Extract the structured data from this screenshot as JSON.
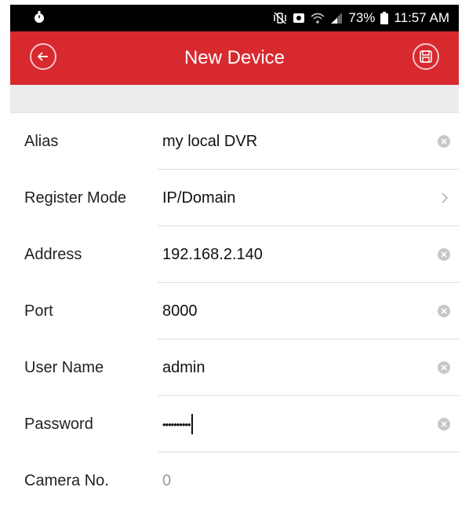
{
  "status_bar": {
    "left_icon": "stopwatch-icon",
    "icons": [
      "mute-vibrate-icon",
      "alarm-icon",
      "wifi-icon",
      "signal-icon"
    ],
    "battery_text": "73%",
    "battery_icon": "battery-icon",
    "time": "11:57 AM"
  },
  "header": {
    "title": "New Device",
    "back_icon": "back-arrow-icon",
    "save_icon": "save-icon",
    "accent_color": "#d8292f"
  },
  "form": {
    "fields": [
      {
        "label": "Alias",
        "value": "my local DVR",
        "action_icon": "clear-icon"
      },
      {
        "label": "Register Mode",
        "value": "IP/Domain",
        "action_icon": "chevron-right-icon"
      },
      {
        "label": "Address",
        "value": "192.168.2.140",
        "action_icon": "clear-icon"
      },
      {
        "label": "Port",
        "value": "8000",
        "action_icon": "clear-icon"
      },
      {
        "label": "User Name",
        "value": "admin",
        "action_icon": "clear-icon"
      },
      {
        "label": "Password",
        "value": "••••••••••",
        "action_icon": "clear-icon"
      },
      {
        "label": "Camera No.",
        "value": "0"
      }
    ]
  }
}
